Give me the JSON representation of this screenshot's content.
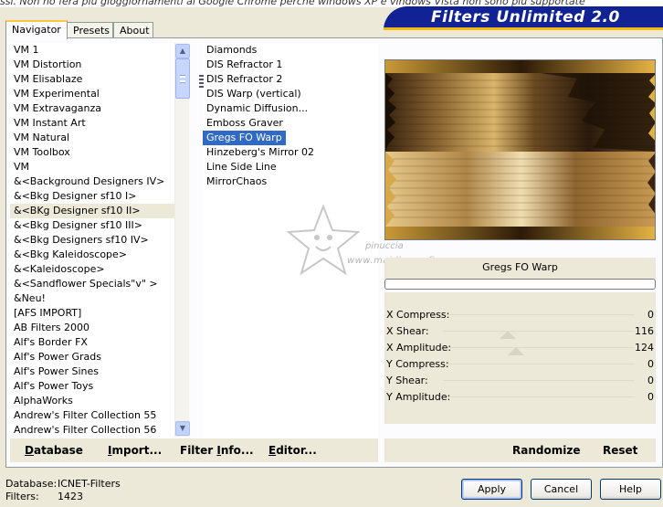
{
  "top_strip_text": "ssi. Non ho ferà più gioggiornamenti al Google Chrome perché windows XP e vindows Vista non sono più supportate",
  "banner": {
    "title": "Filters Unlimited 2.0"
  },
  "tabs": [
    {
      "label": "Navigator",
      "active": true
    },
    {
      "label": "Presets",
      "active": false
    },
    {
      "label": "About",
      "active": false
    }
  ],
  "categories": [
    "VM 1",
    "VM Distortion",
    "VM Elisablaze",
    "VM Experimental",
    "VM Extravaganza",
    "VM Instant Art",
    "VM Natural",
    "VM Toolbox",
    "VM",
    "&<Background Designers IV>",
    "&<Bkg Designer sf10 I>",
    "&<BKg Designer sf10 II>",
    "&<Bkg Designer sf10 III>",
    "&<Bkg Designers sf10 IV>",
    "&<Bkg Kaleidoscope>",
    "&<Kaleidoscope>",
    "&<Sandflower Specials\"v\" >",
    "&Neu!",
    "[AFS IMPORT]",
    "AB Filters 2000",
    "Alf's Border FX",
    "Alf's Power Grads",
    "Alf's Power Sines",
    "Alf's Power Toys",
    "AlphaWorks",
    "Andrew's Filter Collection 55",
    "Andrew's Filter Collection 56"
  ],
  "highlighted_category": 11,
  "filters": [
    "Diamonds",
    "DIS Refractor 1",
    "DIS Refractor 2",
    "DIS Warp (vertical)",
    "Dynamic Diffusion...",
    "Emboss Graver",
    "Gregs FO Warp",
    "Hinzeberg's Mirror 02",
    "Line Side Line",
    "MirrorChaos"
  ],
  "selected_filter": 6,
  "watermark": {
    "line1": "pinuccia",
    "line2": "www.maidiregrafica.eu"
  },
  "preview_label": "Gregs FO Warp",
  "progress": 0,
  "params": [
    {
      "label": "X Compress:",
      "value": "0"
    },
    {
      "label": "X Shear:",
      "value": "116"
    },
    {
      "label": "X Amplitude:",
      "value": "124"
    },
    {
      "label": "Y Compress:",
      "value": "0"
    },
    {
      "label": "Y Shear:",
      "value": "0"
    },
    {
      "label": "Y Amplitude:",
      "value": "0"
    }
  ],
  "left_buttons": {
    "database": {
      "underline": "D",
      "rest": "atabase"
    },
    "import": {
      "underline": "I",
      "rest": "mport..."
    },
    "filter_info": {
      "pre": "Filter ",
      "underline": "I",
      "rest": "nfo..."
    },
    "editor": {
      "underline": "E",
      "rest": "ditor..."
    }
  },
  "right_buttons": {
    "randomize": "Randomize",
    "reset": "Reset"
  },
  "status": {
    "database_label": "Database:",
    "database_value": "ICNET-Filters",
    "filters_label": "Filters:",
    "filters_value": "1423"
  },
  "dialog_buttons": {
    "apply": "Apply",
    "cancel": "Cancel",
    "help": "Help"
  },
  "colors": {
    "selection": "#316AC5",
    "banner": "#102294",
    "banner_accent": "#F3B90E",
    "background": "#ECE9D8"
  }
}
